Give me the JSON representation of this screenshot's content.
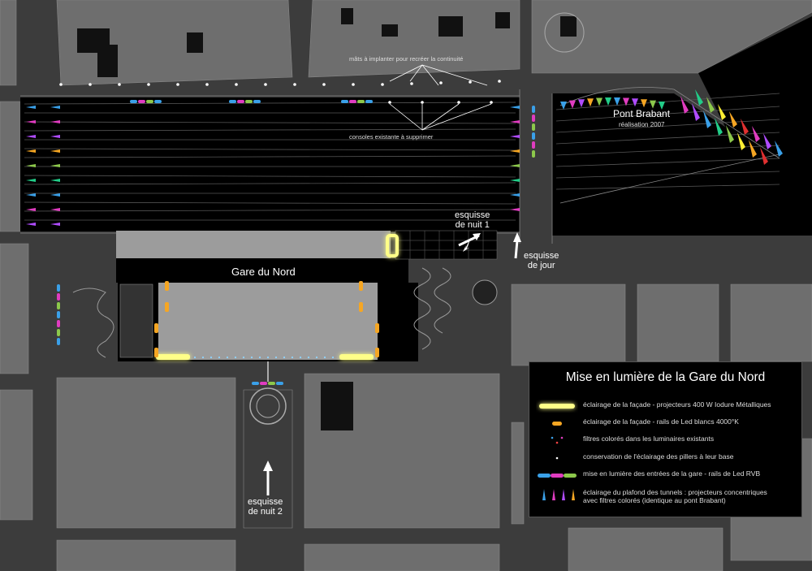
{
  "map": {
    "title": "Gare du Nord",
    "annotations": {
      "mats": "mâts à implanter pour recréer la continuité",
      "consoles": "consoles existante à supprimer",
      "pont_name": "Pont Brabant",
      "pont_year": "réalisation 2007",
      "nuit1": "esquisse\nde nuit 1",
      "jour": "esquisse\nde jour",
      "nuit2": "esquisse\nde nuit 2"
    }
  },
  "legend": {
    "title": "Mise en lumière de la Gare du Nord",
    "items": [
      {
        "icon": "yellow-bar",
        "text": "éclairage de la façade - projecteurs 400 W Iodure Métalliques"
      },
      {
        "icon": "orange-dash",
        "text": "éclairage de la façade - rails de Led blancs 4000°K"
      },
      {
        "icon": "colored-dots",
        "text": "filtres colorés dans les luminaires existants"
      },
      {
        "icon": "white-dot",
        "text": "conservation de l'éclairage des pillers à leur base"
      },
      {
        "icon": "rgb-bar",
        "text": "mise en lumière des entrées de la gare - rails de Led RVB"
      },
      {
        "icon": "cone-projectors",
        "text": "éclairage du plafond des tunnels : projecteurs concentriques\navec filtres colorés (identique au pont Brabant)"
      }
    ]
  },
  "colors": {
    "background": "#3c3c3c",
    "block": "#6e6e6e",
    "rail_area": "#000000",
    "facade_light": "#ffff88",
    "led_orange": "#f5a623",
    "rgb_blue": "#3aa0e8",
    "rgb_magenta": "#e03cc0",
    "rgb_green": "#8cc84b"
  }
}
